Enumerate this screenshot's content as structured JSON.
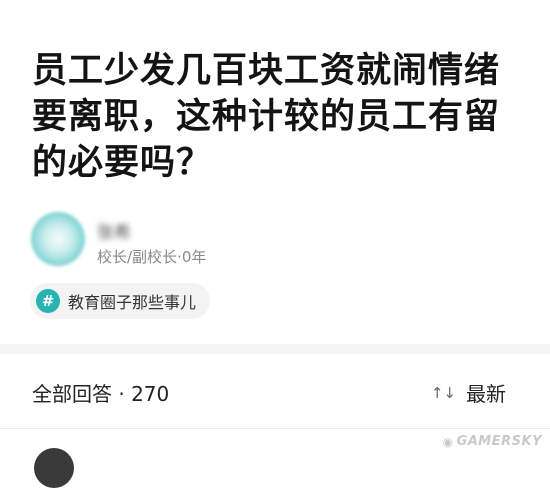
{
  "question": {
    "title": "员工少发几百块工资就闹情绪要离职，这种计较的员工有留的必要吗？"
  },
  "author": {
    "name": "张希",
    "meta": "校长/副校长·0年"
  },
  "topic": {
    "icon": "hash-icon",
    "label": "教育圈子那些事儿",
    "accent_color": "#27b3b3"
  },
  "answers": {
    "count_label": "全部回答 · 270",
    "sort_icon": "sort-icon",
    "sort_label": "最新"
  },
  "watermark": {
    "text": "GAMERSKY"
  }
}
